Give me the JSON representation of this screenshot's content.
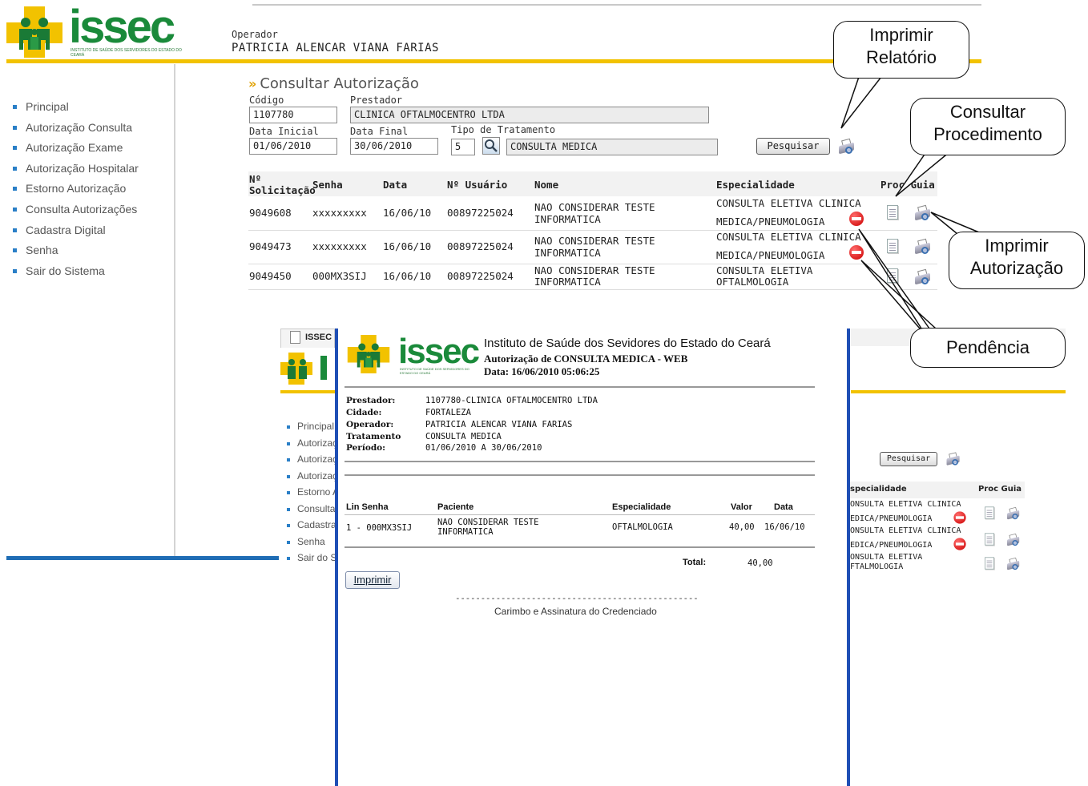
{
  "header": {
    "logo_text": "issec",
    "logo_subtext": "INSTITUTO DE SAÚDE DOS SERVIDORES DO ESTADO DO CEARÁ",
    "operator_label": "Operador",
    "operator_name": "PATRICIA ALENCAR VIANA FARIAS"
  },
  "sidebar": {
    "items": [
      {
        "label": "Principal"
      },
      {
        "label": "Autorização Consulta"
      },
      {
        "label": "Autorização Exame"
      },
      {
        "label": "Autorização Hospitalar"
      },
      {
        "label": "Estorno Autorização"
      },
      {
        "label": "Consulta Autorizações"
      },
      {
        "label": "Cadastra Digital"
      },
      {
        "label": "Senha"
      },
      {
        "label": "Sair do Sistema"
      }
    ]
  },
  "page": {
    "title": "Consultar Autorização"
  },
  "form": {
    "codigo_label": "Código",
    "codigo_value": "1107780",
    "prestador_label": "Prestador",
    "prestador_value": "CLINICA OFTALMOCENTRO LTDA",
    "data_inicial_label": "Data Inicial",
    "data_inicial_value": "01/06/2010",
    "data_final_label": "Data Final",
    "data_final_value": "30/06/2010",
    "tipo_label": "Tipo de Tratamento",
    "tipo_code": "5",
    "tipo_value": "CONSULTA MEDICA",
    "search_button": "Pesquisar"
  },
  "table": {
    "headers": {
      "solicitacao_1": "Nº",
      "solicitacao_2": "Solicitação",
      "senha": "Senha",
      "data": "Data",
      "usuario": "Nº Usuário",
      "nome": "Nome",
      "especialidade": "Especialidade",
      "proc_guia": "Proc Guia"
    },
    "rows": [
      {
        "solicitacao": "9049608",
        "senha": "xxxxxxxxx",
        "data": "16/06/10",
        "usuario": "00897225024",
        "nome_1": "NAO CONSIDERAR TESTE",
        "nome_2": "INFORMATICA",
        "esp_1": "CONSULTA ELETIVA CLINICA",
        "esp_2": "MEDICA/PNEUMOLOGIA",
        "pendencia": true
      },
      {
        "solicitacao": "9049473",
        "senha": "xxxxxxxxx",
        "data": "16/06/10",
        "usuario": "00897225024",
        "nome_1": "NAO CONSIDERAR TESTE",
        "nome_2": "INFORMATICA",
        "esp_1": "CONSULTA ELETIVA CLINICA",
        "esp_2": "MEDICA/PNEUMOLOGIA",
        "pendencia": true
      },
      {
        "solicitacao": "9049450",
        "senha": "000MX3SIJ",
        "data": "16/06/10",
        "usuario": "00897225024",
        "nome_1": "NAO CONSIDERAR TESTE",
        "nome_2": "INFORMATICA",
        "esp_1": "CONSULTA ELETIVA",
        "esp_2": "OFTALMOLOGIA",
        "pendencia": false
      }
    ]
  },
  "popup": {
    "tab_label": "ISSEC",
    "title": "Instituto de Saúde dos Sevidores do Estado do Ceará",
    "subtitle": "Autorização de CONSULTA MEDICA - WEB",
    "date_line": "Data: 16/06/2010 05:06:25",
    "info": [
      {
        "key": "Prestador:",
        "value": "1107780-CLINICA OFTALMOCENTRO LTDA"
      },
      {
        "key": "Cidade:",
        "value": "FORTALEZA"
      },
      {
        "key": "Operador:",
        "value": "PATRICIA ALENCAR VIANA FARIAS"
      },
      {
        "key": "Tratamento",
        "value": "CONSULTA MEDICA"
      },
      {
        "key": "Período:",
        "value": "01/06/2010 A 30/06/2010"
      }
    ],
    "cols": {
      "lin_senha": "Lin Senha",
      "paciente": "Paciente",
      "especialidade": "Especialidade",
      "valor": "Valor",
      "data": "Data"
    },
    "row": {
      "lin_senha": "1 - 000MX3SIJ",
      "paciente_1": "NAO CONSIDERAR TESTE",
      "paciente_2": "INFORMATICA",
      "especialidade": "OFTALMOLOGIA",
      "valor": "40,00",
      "data": "16/06/10"
    },
    "total_label": "Total:",
    "total_value": "40,00",
    "print_button": "Imprimir",
    "signature_line": "------------------------------------------------",
    "signature_text": "Carimbo e Assinatura do Credenciado",
    "bg_nav": [
      "Principal",
      "Autorizaç",
      "Autorizaç",
      "Autorizaç",
      "Estorno A",
      "Consulta",
      "Cadastra",
      "Senha",
      "Sair do S"
    ],
    "bg_search_button": "Pesquisar",
    "bg_headers": {
      "especialidade": "specialidade",
      "proc_guia": "Proc Guia"
    },
    "bg_rows": [
      {
        "esp_1": "ONSULTA ELETIVA CLINICA",
        "esp_2": "EDICA/PNEUMOLOGIA",
        "pendencia": true
      },
      {
        "esp_1": "ONSULTA ELETIVA CLINICA",
        "esp_2": "EDICA/PNEUMOLOGIA",
        "pendencia": true
      },
      {
        "esp_1": "ONSULTA ELETIVA",
        "esp_2": "FTALMOLOGIA",
        "pendencia": false
      }
    ]
  },
  "callouts": {
    "imprimir_relatorio_1": "Imprimir",
    "imprimir_relatorio_2": "Relatório",
    "consultar_procedimento_1": "Consultar",
    "consultar_procedimento_2": "Procedimento",
    "imprimir_autorizacao_1": "Imprimir",
    "imprimir_autorizacao_2": "Autorização",
    "pendencia": "Pendência"
  },
  "colors": {
    "brand_green": "#1a8a3a",
    "brand_yellow": "#f2c200",
    "nav_blue": "#1f6db5",
    "popup_border_blue": "#1f4fb5"
  }
}
